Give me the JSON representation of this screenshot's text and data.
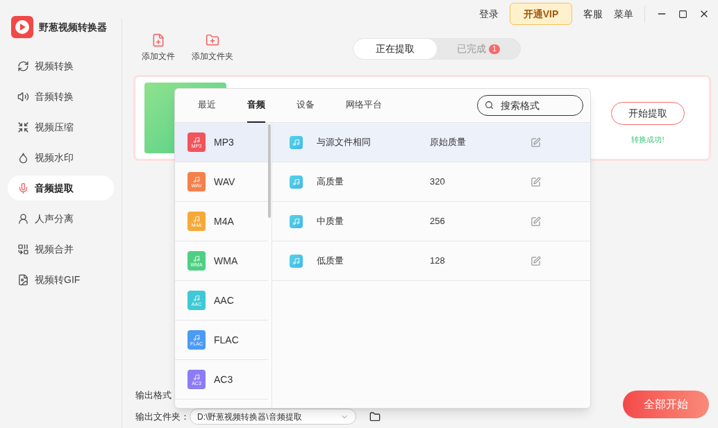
{
  "app": {
    "name": "野葱视频转换器"
  },
  "header": {
    "login": "登录",
    "vip": "开通VIP",
    "service": "客服",
    "menu": "菜单"
  },
  "sidebar": {
    "items": [
      {
        "label": "视频转换",
        "selected": false
      },
      {
        "label": "音频转换",
        "selected": false
      },
      {
        "label": "视频压缩",
        "selected": false
      },
      {
        "label": "视频水印",
        "selected": false
      },
      {
        "label": "音频提取",
        "selected": true
      },
      {
        "label": "人声分离",
        "selected": false
      },
      {
        "label": "视频合并",
        "selected": false
      },
      {
        "label": "视频转GIF",
        "selected": false
      }
    ]
  },
  "toolbar": [
    {
      "label": "添加文件",
      "kind": "file"
    },
    {
      "label": "添加文件夹",
      "kind": "folder"
    }
  ],
  "status_tabs": [
    {
      "label": "正在提取",
      "selected": true
    },
    {
      "label": "已完成",
      "selected": false,
      "badge": "1"
    }
  ],
  "task": {
    "action": "开始提取",
    "status": "转换成功!"
  },
  "format_popup": {
    "tabs": [
      {
        "label": "最近",
        "selected": false
      },
      {
        "label": "音频",
        "selected": true
      },
      {
        "label": "设备",
        "selected": false
      },
      {
        "label": "网络平台",
        "selected": false
      }
    ],
    "search": {
      "placeholder": "搜索格式"
    },
    "formats": [
      {
        "name": "MP3",
        "icon_label": "MP3",
        "color": "#f2545b",
        "selected": true
      },
      {
        "name": "WAV",
        "icon_label": "WAV",
        "color": "#f5804a",
        "selected": false
      },
      {
        "name": "M4A",
        "icon_label": "M4A",
        "color": "#f6a93b",
        "selected": false
      },
      {
        "name": "WMA",
        "icon_label": "WMA",
        "color": "#4fcf83",
        "selected": false
      },
      {
        "name": "AAC",
        "icon_label": "AAC",
        "color": "#3fc8d6",
        "selected": false
      },
      {
        "name": "FLAC",
        "icon_label": "FLAC",
        "color": "#4b9af5",
        "selected": false
      },
      {
        "name": "AC3",
        "icon_label": "AC3",
        "color": "#8b7cf6",
        "selected": false
      }
    ],
    "presets": [
      {
        "name": "与源文件相同",
        "quality": "原始质量",
        "selected": true
      },
      {
        "name": "高质量",
        "quality": "320",
        "selected": false
      },
      {
        "name": "中质量",
        "quality": "256",
        "selected": false
      },
      {
        "name": "低质量",
        "quality": "128",
        "selected": false
      }
    ]
  },
  "footer": {
    "format_label": "输出格式",
    "folder_label": "输出文件夹：",
    "folder_path": "D:\\野葱视频转换器\\音频提取",
    "start_all": "全部开始"
  }
}
